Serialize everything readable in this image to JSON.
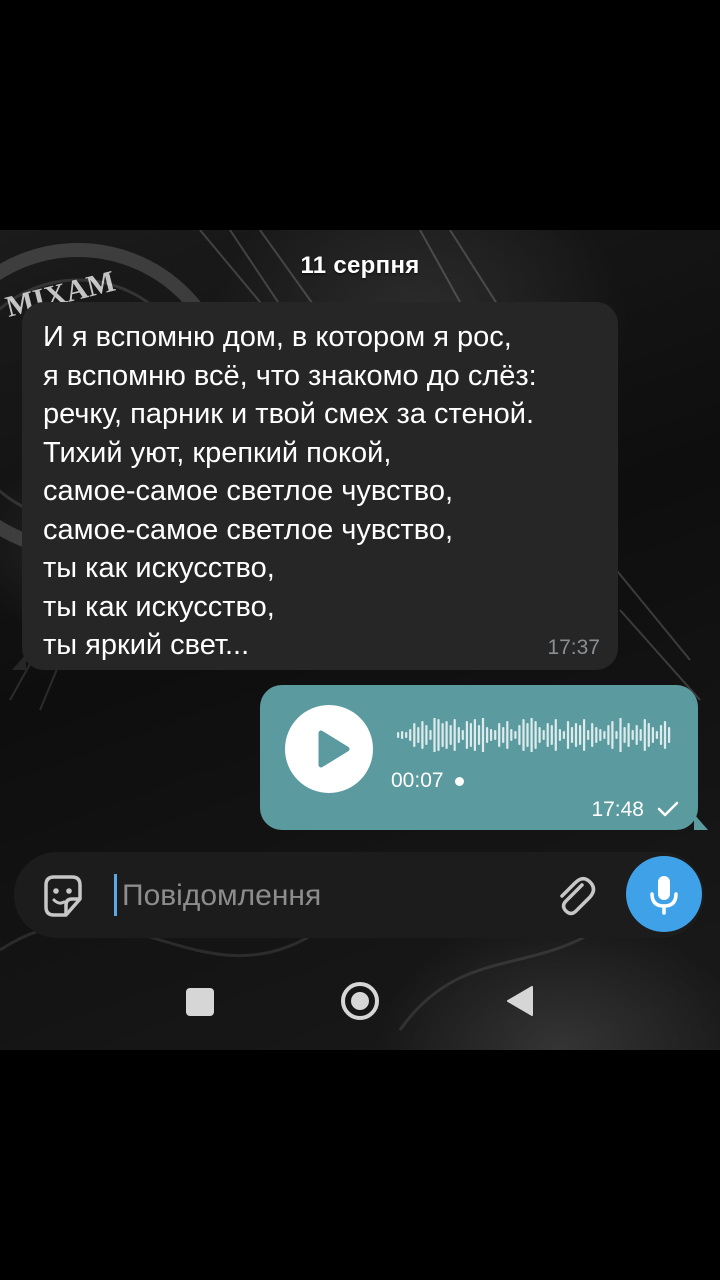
{
  "chat": {
    "date_label": "11 серпня",
    "incoming_message": {
      "lines": [
        "И я вспомню дом, в котором я рос,",
        "я вспомню всё, что знакомо до слёз:",
        "речку, парник и твой смех за стеной.",
        "Тихий уют, крепкий покой,",
        "самое-самое светлое чувство,",
        "самое-самое светлое чувство,",
        "ты как искусство,",
        "ты как искусство,",
        "ты яркий свет..."
      ],
      "time": "17:37"
    },
    "voice_message": {
      "duration": "00:07",
      "time": "17:48",
      "status_icon": "single-check-icon",
      "play_icon": "play-icon"
    }
  },
  "composer": {
    "placeholder": "Повідомлення",
    "sticker_icon": "sticker-icon",
    "attach_icon": "paperclip-icon",
    "mic_icon": "microphone-icon"
  },
  "navbar": {
    "recents_icon": "square-icon",
    "home_icon": "circle-icon",
    "back_icon": "triangle-back-icon"
  },
  "wallpaper": {
    "stamp_text": "MIXAM"
  },
  "colors": {
    "incoming_bubble": "#262626",
    "outgoing_bubble": "#5b9ba0",
    "mic_button": "#3fa2e8",
    "caret": "#5aa9e6"
  }
}
